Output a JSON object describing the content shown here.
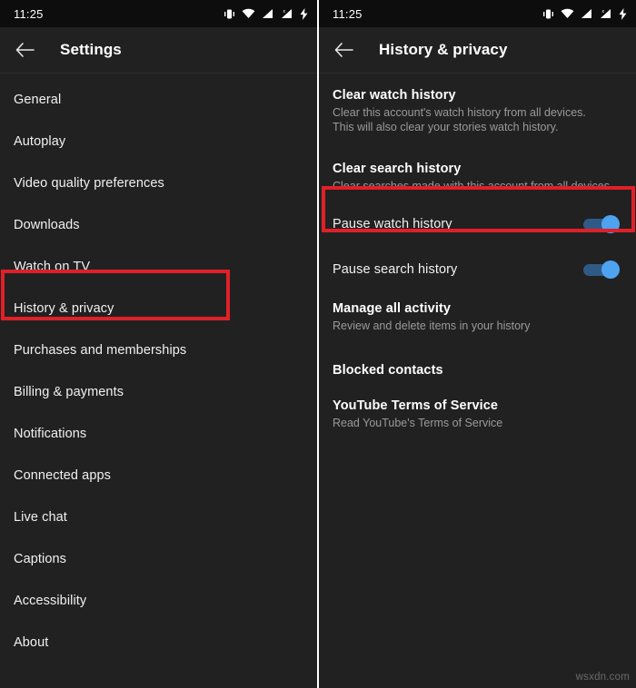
{
  "colors": {
    "status_bar_bg": "#0d0d0d",
    "app_bg": "#212121",
    "highlight_red": "#e02028",
    "toggle_thumb": "#4da3f0",
    "toggle_track": "#2f5a85",
    "primary_text": "#ffffff",
    "secondary_text": "#9a9a9a"
  },
  "status_bar": {
    "clock": "11:25",
    "icons": [
      "vibrate-icon",
      "wifi-icon",
      "signal-bars-icon",
      "signal-bars-no-service-icon",
      "battery-charging-icon"
    ]
  },
  "left_panel": {
    "app_bar": {
      "back_icon": "back-arrow-icon",
      "title": "Settings"
    },
    "items": [
      {
        "label": "General"
      },
      {
        "label": "Autoplay"
      },
      {
        "label": "Video quality preferences"
      },
      {
        "label": "Downloads"
      },
      {
        "label": "Watch on TV"
      },
      {
        "label": "History & privacy",
        "highlighted": true
      },
      {
        "label": "Purchases and memberships"
      },
      {
        "label": "Billing & payments"
      },
      {
        "label": "Notifications"
      },
      {
        "label": "Connected apps"
      },
      {
        "label": "Live chat"
      },
      {
        "label": "Captions"
      },
      {
        "label": "Accessibility"
      },
      {
        "label": "About"
      }
    ]
  },
  "right_panel": {
    "app_bar": {
      "back_icon": "back-arrow-icon",
      "title": "History & privacy"
    },
    "items": [
      {
        "type": "detail",
        "title": "Clear watch history",
        "subtitle": "Clear this account's watch history from all devices. This will also clear your stories watch history."
      },
      {
        "type": "detail",
        "title": "Clear search history",
        "subtitle": "Clear searches made with this account from all devices"
      },
      {
        "type": "toggle",
        "title": "Pause watch history",
        "toggle_on": true,
        "highlighted": true
      },
      {
        "type": "toggle",
        "title": "Pause search history",
        "toggle_on": true
      },
      {
        "type": "detail",
        "title": "Manage all activity",
        "subtitle": "Review and delete items in your history"
      },
      {
        "type": "plain",
        "title": "Blocked contacts"
      },
      {
        "type": "detail",
        "title": "YouTube Terms of Service",
        "subtitle": "Read YouTube's Terms of Service"
      }
    ],
    "watermark": "wsxdn.com"
  }
}
